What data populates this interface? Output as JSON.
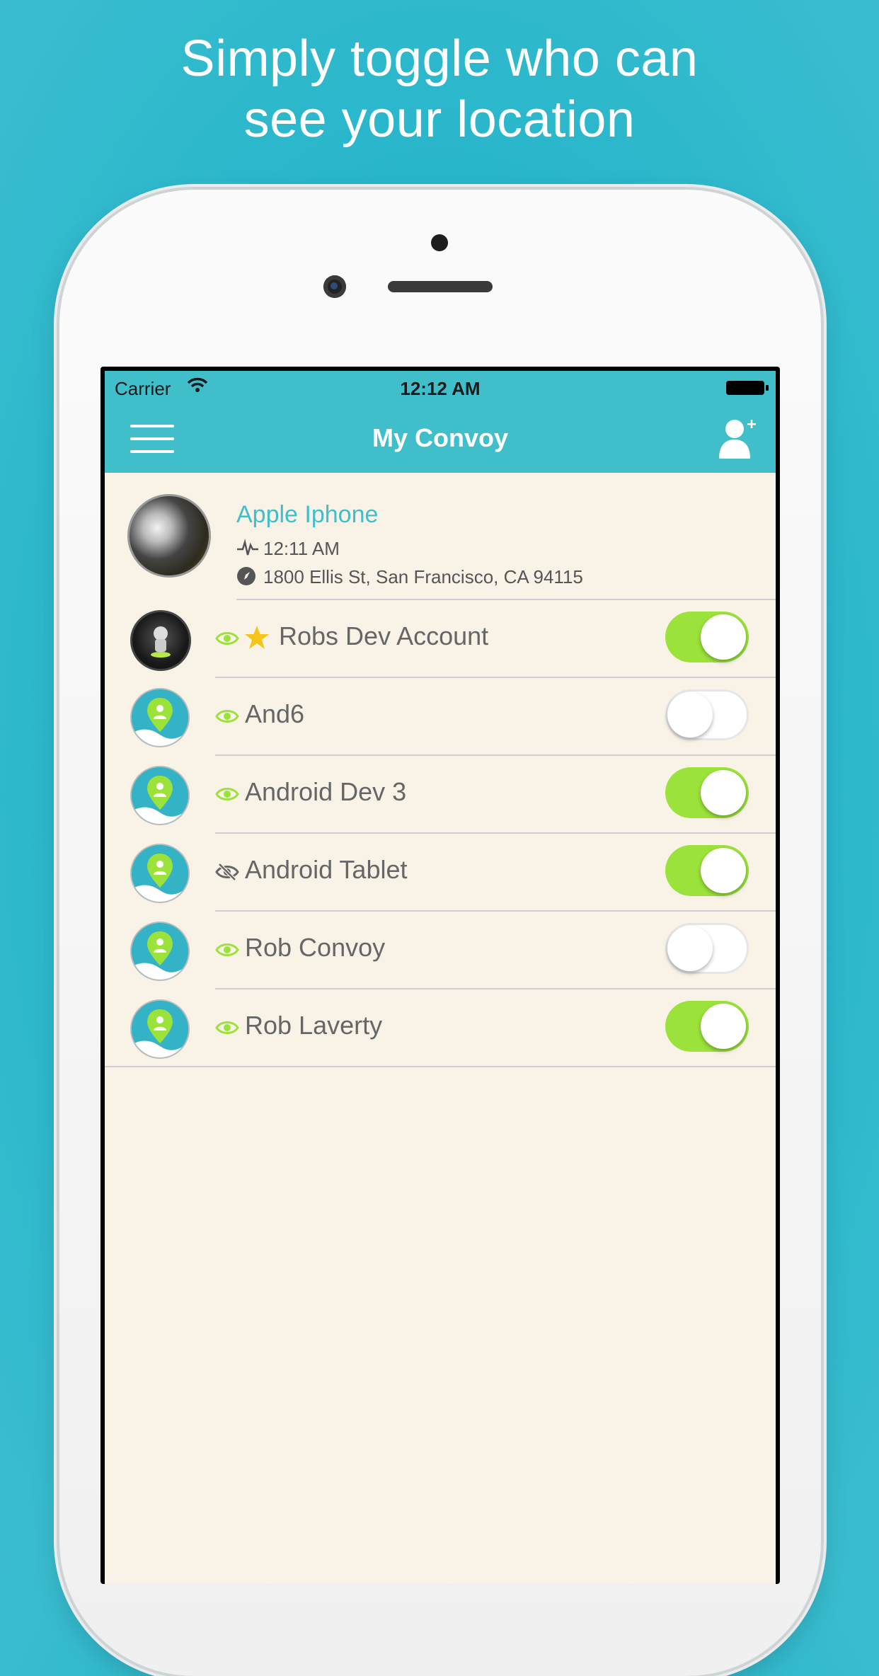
{
  "headline": {
    "line1": "Simply toggle who can",
    "line2": "see your location"
  },
  "status_bar": {
    "carrier": "Carrier",
    "time": "12:12 AM"
  },
  "nav": {
    "title": "My Convoy",
    "menu_icon": "hamburger-menu-icon",
    "add_icon": "add-user-icon"
  },
  "profile": {
    "name": "Apple Iphone",
    "time": "12:11 AM",
    "address": "1800 Ellis St, San Francisco, CA 94115"
  },
  "contacts": [
    {
      "name": "Robs Dev Account",
      "visible": true,
      "starred": true,
      "sharing": true
    },
    {
      "name": "And6",
      "visible": true,
      "starred": false,
      "sharing": false
    },
    {
      "name": "Android Dev 3",
      "visible": true,
      "starred": false,
      "sharing": true
    },
    {
      "name": "Android Tablet",
      "visible": false,
      "starred": false,
      "sharing": true
    },
    {
      "name": "Rob Convoy",
      "visible": true,
      "starred": false,
      "sharing": false
    },
    {
      "name": "Rob Laverty",
      "visible": true,
      "starred": false,
      "sharing": true
    }
  ],
  "colors": {
    "accent": "#40bfcb",
    "toggle_on": "#9be23a",
    "list_background": "#f9f2e7",
    "star": "#f5c518"
  }
}
